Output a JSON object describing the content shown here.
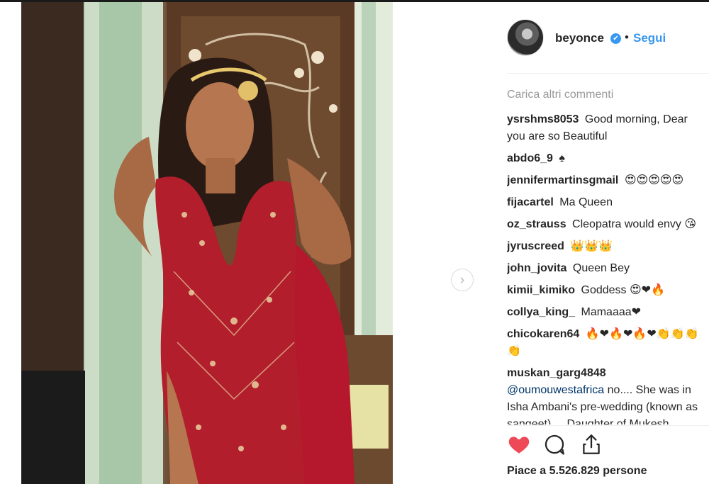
{
  "post": {
    "image_alt": "Photo by beyonce",
    "next_arrow": "›"
  },
  "header": {
    "username": "beyonce",
    "verified_mark": "✔",
    "separator": "•",
    "follow_label": "Segui"
  },
  "comments_section": {
    "load_more_label": "Carica altri commenti",
    "items": [
      {
        "user": "ysrshms8053",
        "text": "Good morning, Dear you are so Beautiful"
      },
      {
        "user": "abdo6_9",
        "text": "♠"
      },
      {
        "user": "jennifermartinsgmail",
        "text": "😍😍😍😍😍"
      },
      {
        "user": "fijacartel",
        "text": "Ma Queen"
      },
      {
        "user": "oz_strauss",
        "text": "Cleopatra would envy 😘"
      },
      {
        "user": "jyruscreed",
        "text": "👑👑👑"
      },
      {
        "user": "john_jovita",
        "text": "Queen Bey"
      },
      {
        "user": "kimii_kimiko",
        "text": "Goddess 😍❤🔥"
      },
      {
        "user": "collya_king_",
        "text": "Mamaaaa❤"
      },
      {
        "user": "chicokaren64",
        "text": "🔥❤🔥❤🔥❤👏👏👏👏"
      },
      {
        "user": "muskan_garg4848",
        "mention": "@oumouwestafrica",
        "text": "no.... She was in Isha Ambani's pre-wedding (known as sangeet).... Daughter of Mukesh Ambani ... India"
      }
    ]
  },
  "actions": {
    "like_icon": "heart-icon",
    "comment_icon": "comment-icon",
    "share_icon": "share-icon",
    "like_color": "#ed4956"
  },
  "likes": {
    "text": "Piace a 5.526.829 persone"
  },
  "colors": {
    "link_blue": "#3897f0",
    "muted": "#999999",
    "text": "#262626"
  }
}
